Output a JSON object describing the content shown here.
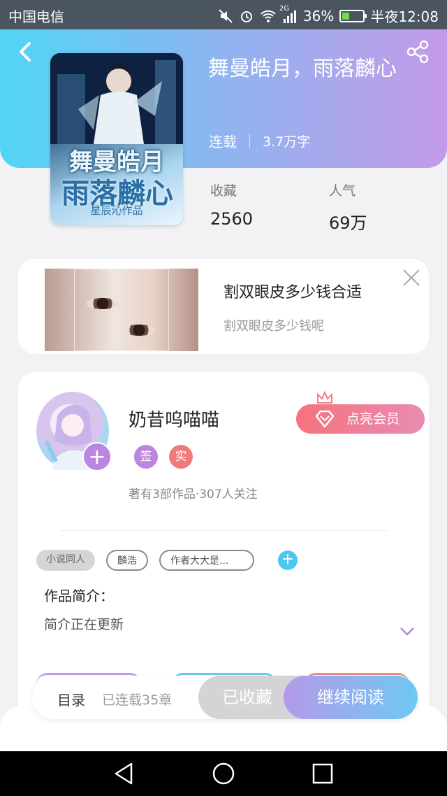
{
  "status_bar": {
    "carrier": "中国电信",
    "network": "2G",
    "battery": "36%",
    "battery_level": 0.36,
    "time": "半夜12:08"
  },
  "cover": {
    "title_line1": "舞曼皓月",
    "title_line2": "雨落麟心",
    "author_mark": "星辰沁作品"
  },
  "book": {
    "title": "舞曼皓月，雨落麟心",
    "status": "连载",
    "word_count": "3.7万字"
  },
  "stats": {
    "favorites_label": "收藏",
    "favorites_value": "2560",
    "popularity_label": "人气",
    "popularity_value": "69万"
  },
  "ad": {
    "title": "割双眼皮多少钱合适",
    "subtitle": "割双眼皮多少钱呢"
  },
  "author": {
    "name": "奶昔呜喵喵",
    "badge_signed": "签",
    "badge_verified": "实",
    "stats": "著有3部作品·307人关注",
    "vip_label": "点亮会员"
  },
  "tags": [
    "小说同人",
    "麟浩",
    "作者大大是..."
  ],
  "intro": {
    "label": "作品简介：",
    "text": "简介正在更新"
  },
  "bottom_bar": {
    "toc_label": "目录",
    "chapters": "已连载35章",
    "favorited_label": "已收藏",
    "continue_label": "继续阅读"
  },
  "colors": {
    "header_start": "#51d5f5",
    "header_end": "#c49ae8",
    "vip_start": "#f5727e",
    "vip_end": "#e88cb3",
    "read_start": "#b49ae8",
    "read_end": "#6ec8f2",
    "badge_signed": "#bb86df",
    "badge_verified": "#f07a7a",
    "tag_add": "#4cc8f0"
  }
}
